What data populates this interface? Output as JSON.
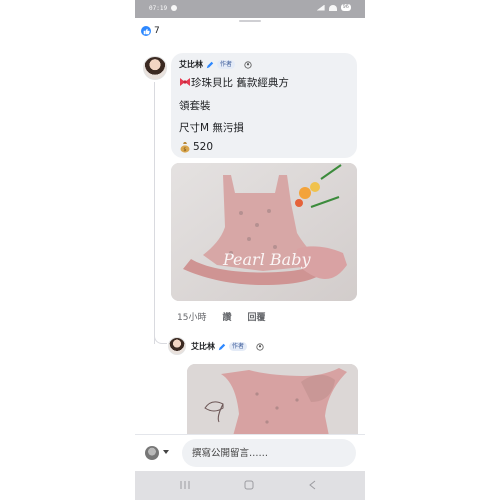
{
  "status_bar": {
    "time": "07:19",
    "battery": "96"
  },
  "reactions": {
    "icon": "like-icon",
    "count": "7",
    "color": "#2d88ff"
  },
  "comment": {
    "author": "艾比林",
    "author_tag": "作者",
    "lines": [
      "珍珠貝比 舊款經典方",
      "領套裝",
      "尺寸M 無污損"
    ],
    "price": "520",
    "photo_watermark": "Pearl Baby",
    "time": "15小時",
    "like_label": "讚",
    "reply_label": "回覆"
  },
  "reply": {
    "author": "艾比林",
    "author_tag": "作者"
  },
  "composer": {
    "placeholder": "撰寫公開留言……"
  }
}
